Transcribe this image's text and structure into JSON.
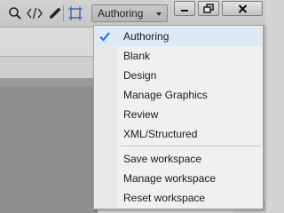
{
  "toolbar": {
    "icons": [
      "search-icon",
      "code-view-icon",
      "pen-icon",
      "frame-icon"
    ],
    "workspace_label": "Authoring"
  },
  "window_controls": [
    "minimize-icon",
    "restore-icon",
    "close-icon"
  ],
  "workspace_menu": {
    "selected": "Authoring",
    "workspaces": [
      {
        "label": "Authoring",
        "checked": true
      },
      {
        "label": "Blank",
        "checked": false
      },
      {
        "label": "Design",
        "checked": false
      },
      {
        "label": "Manage Graphics",
        "checked": false
      },
      {
        "label": "Review",
        "checked": false
      },
      {
        "label": "XML/Structured",
        "checked": false
      }
    ],
    "actions": [
      {
        "label": "Save workspace"
      },
      {
        "label": "Manage workspace"
      },
      {
        "label": "Reset workspace"
      }
    ],
    "check_icon": "checkmark-icon",
    "check_color": "#2a7bd3"
  }
}
